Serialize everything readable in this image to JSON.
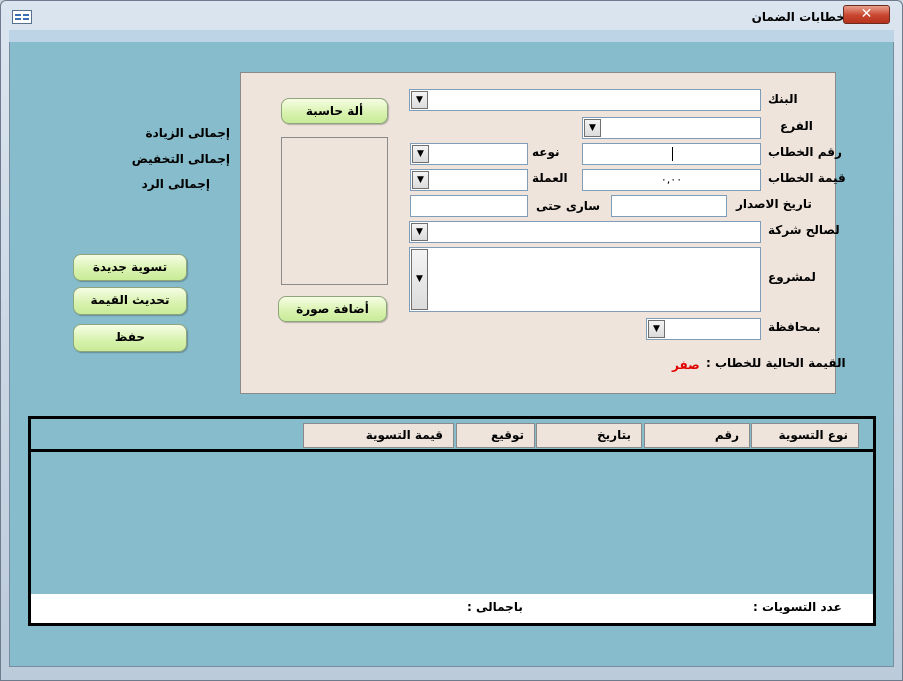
{
  "window": {
    "title": "خطابات الضمان",
    "close": "✕"
  },
  "form": {
    "bank_label": "البنك",
    "branch_label": "الفرع",
    "letter_no_label": "رقم الخطاب",
    "type_label": "نوعه",
    "letter_value_label": "قيمة الخطاب",
    "letter_value": "٠,٠٠",
    "currency_label": "العملة",
    "issue_date_label": "تاريخ الاصدار",
    "valid_until_label": "سارى حتى",
    "beneficiary_label": "لصالح شركة",
    "project_label": "لمشروع",
    "governorate_label": "بمحافظة",
    "current_value_label": "القيمة الحالية للخطاب :",
    "current_value": "صفر",
    "dropdown_arrow": "▼"
  },
  "buttons": {
    "calculator": "ألة حاسبة",
    "add_image": "أضافة صورة",
    "new_settlement": "تسوية جديدة",
    "update_value": "تحديث القيمة",
    "save": "حفظ"
  },
  "totals": {
    "increase": "إجمالى الزيادة",
    "decrease": "إجمالى التخفيض",
    "refund": "إجمالى الرد"
  },
  "grid": {
    "columns": [
      "نوع التسوية",
      "رقم",
      "بتاريخ",
      "توقيع",
      "قيمة التسوية"
    ],
    "count_label": "عدد التسويات :",
    "total_label": "باجمالى :"
  },
  "colors": {
    "client_bg": "#86bccb",
    "panel_bg": "#efe4dc",
    "button_green": "#d7f2ad",
    "value_red": "#e00000"
  }
}
